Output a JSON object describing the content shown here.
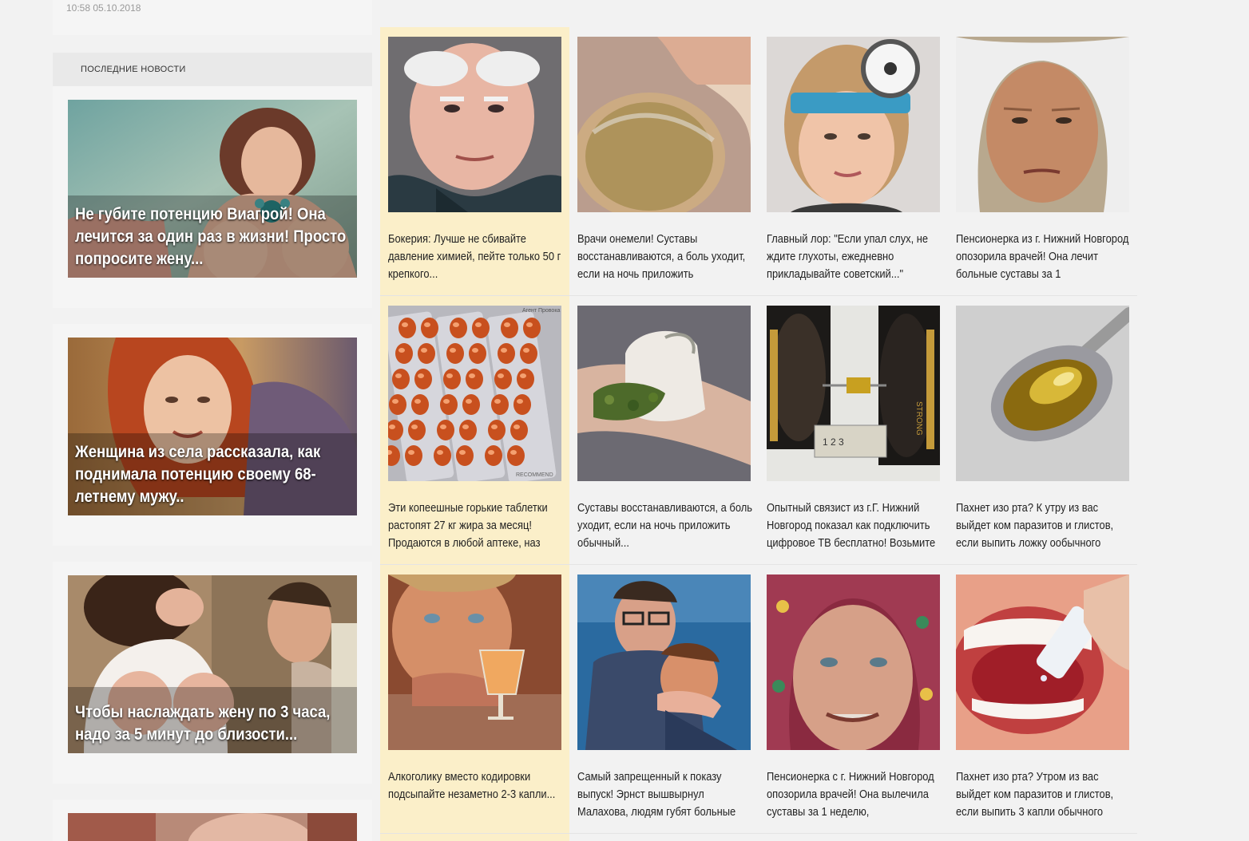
{
  "sidebar": {
    "date": "10:58 05.10.2018",
    "section_title": "ПОСЛЕДНИЕ НОВОСТИ",
    "cards": [
      {
        "caption": "Не губите потенцию Виагрой! Она лечится за один раз в жизни! Просто попросите жену..."
      },
      {
        "caption": "Женщина из села рассказала, как поднимала потенцию своему 68-летнему мужу.."
      },
      {
        "caption": "Чтобы наслаждать жену по 3 часа, надо за 5 минут до близости..."
      },
      {
        "caption": ""
      }
    ]
  },
  "grid": {
    "items": [
      {
        "title": "Бокерия: Лучше не сбивайте давление химией, пейте только 50 г крепкого...",
        "highlight": true
      },
      {
        "title": "Врачи онемели! Суставы восстанавливаются, а боль уходит, если на ночь приложить"
      },
      {
        "title": "Главный лор: \"Если упал слух, не ждите глухоты, ежедневно прикладывайте советский...\""
      },
      {
        "title": "Пенсионерка из г. Нижний Новгород опозорила врачей! Она лечит больные суставы за 1"
      },
      {
        "title": "Эти копеешные горькие таблетки растопят 27 кг жира за месяц! Продаются в любой аптеке, наз",
        "highlight": true
      },
      {
        "title": "Суставы восстанавливаются, а боль уходит, если на ночь приложить обычный..."
      },
      {
        "title": "Опытный связист из г.Г. Нижний Новгород показал как подключить цифровое ТВ бесплатно! Возьмите"
      },
      {
        "title": "Пахнет изо рта? К утру из вас выйдет ком паразитов и глистов, если выпить ложку ообычного"
      },
      {
        "title": "Алкоголику вместо кодировки подсыпайте незаметно 2-3 капли...",
        "highlight": true
      },
      {
        "title": "Самый запрещенный к показу выпуск! Эрнст вышвырнул Малахова, людям губят больные"
      },
      {
        "title": "Пенсионерка с г. Нижний Новгород опозорила врачей! Она вылечила суставы за 1 неделю,"
      },
      {
        "title": "Пахнет изо рта? Утром из вас выйдет ком паразитов и глистов, если выпить 3 капли обычного"
      }
    ],
    "image_labels": {
      "pills_watermark": "Агент Провока",
      "pills_watermark2": "RECOMMEND",
      "ruler_digits": "1 2 3",
      "can_text": "STRONG"
    }
  }
}
